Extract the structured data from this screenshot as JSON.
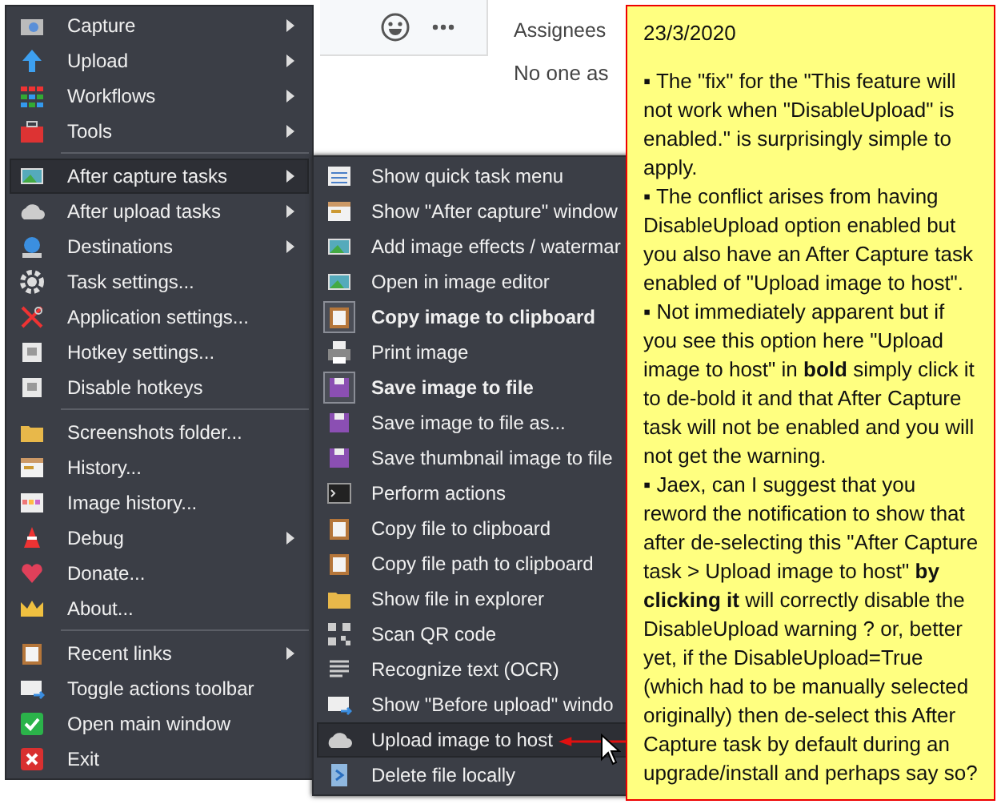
{
  "background": {
    "sidebar": [
      {
        "text": "Assignees",
        "kind": "heading"
      },
      {
        "text": "No one as",
        "kind": "value"
      }
    ]
  },
  "main_menu": [
    {
      "kind": "item",
      "label": "Capture",
      "submenu": true,
      "highlighted": false
    },
    {
      "kind": "item",
      "label": "Upload",
      "submenu": true,
      "highlighted": false
    },
    {
      "kind": "item",
      "label": "Workflows",
      "submenu": true,
      "highlighted": false
    },
    {
      "kind": "item",
      "label": "Tools",
      "submenu": true,
      "highlighted": false
    },
    {
      "kind": "separator"
    },
    {
      "kind": "item",
      "label": "After capture tasks",
      "submenu": true,
      "highlighted": true
    },
    {
      "kind": "item",
      "label": "After upload tasks",
      "submenu": true,
      "highlighted": false
    },
    {
      "kind": "item",
      "label": "Destinations",
      "submenu": true,
      "highlighted": false
    },
    {
      "kind": "item",
      "label": "Task settings...",
      "submenu": false,
      "highlighted": false
    },
    {
      "kind": "item",
      "label": "Application settings...",
      "submenu": false,
      "highlighted": false
    },
    {
      "kind": "item",
      "label": "Hotkey settings...",
      "submenu": false,
      "highlighted": false
    },
    {
      "kind": "item",
      "label": "Disable hotkeys",
      "submenu": false,
      "highlighted": false
    },
    {
      "kind": "separator"
    },
    {
      "kind": "item",
      "label": "Screenshots folder...",
      "submenu": false,
      "highlighted": false
    },
    {
      "kind": "item",
      "label": "History...",
      "submenu": false,
      "highlighted": false
    },
    {
      "kind": "item",
      "label": "Image history...",
      "submenu": false,
      "highlighted": false
    },
    {
      "kind": "item",
      "label": "Debug",
      "submenu": true,
      "highlighted": false
    },
    {
      "kind": "item",
      "label": "Donate...",
      "submenu": false,
      "highlighted": false
    },
    {
      "kind": "item",
      "label": "About...",
      "submenu": false,
      "highlighted": false
    },
    {
      "kind": "separator"
    },
    {
      "kind": "item",
      "label": "Recent links",
      "submenu": true,
      "highlighted": false
    },
    {
      "kind": "item",
      "label": "Toggle actions toolbar",
      "submenu": false,
      "highlighted": false
    },
    {
      "kind": "item",
      "label": "Open main window",
      "submenu": false,
      "highlighted": false
    },
    {
      "kind": "item",
      "label": "Exit",
      "submenu": false,
      "highlighted": false
    }
  ],
  "submenu": [
    {
      "label": "Show quick task menu",
      "checked": false,
      "highlighted": false
    },
    {
      "label": "Show \"After capture\" window",
      "checked": false,
      "highlighted": false
    },
    {
      "label": "Add image effects / watermar",
      "checked": false,
      "highlighted": false
    },
    {
      "label": "Open in image editor",
      "checked": false,
      "highlighted": false
    },
    {
      "label": "Copy image to clipboard",
      "checked": true,
      "highlighted": false
    },
    {
      "label": "Print image",
      "checked": false,
      "highlighted": false
    },
    {
      "label": "Save image to file",
      "checked": true,
      "highlighted": false
    },
    {
      "label": "Save image to file as...",
      "checked": false,
      "highlighted": false
    },
    {
      "label": "Save thumbnail image to file",
      "checked": false,
      "highlighted": false
    },
    {
      "label": "Perform actions",
      "checked": false,
      "highlighted": false
    },
    {
      "label": "Copy file to clipboard",
      "checked": false,
      "highlighted": false
    },
    {
      "label": "Copy file path to clipboard",
      "checked": false,
      "highlighted": false
    },
    {
      "label": "Show file in explorer",
      "checked": false,
      "highlighted": false
    },
    {
      "label": "Scan QR code",
      "checked": false,
      "highlighted": false
    },
    {
      "label": "Recognize text (OCR)",
      "checked": false,
      "highlighted": false
    },
    {
      "label": "Show \"Before upload\" windo",
      "checked": false,
      "highlighted": false
    },
    {
      "label": "Upload image to host",
      "checked": false,
      "highlighted": true
    },
    {
      "label": "Delete file locally",
      "checked": false,
      "highlighted": false
    }
  ],
  "note": {
    "date": "23/3/2020",
    "paragraphs": [
      "▪ The \"fix\" for the \"This feature will not work when \"DisableUpload\" is enabled.\" is surprisingly simple to apply.",
      "▪ The conflict arises from having DisableUpload option enabled but you also have an After Capture task enabled of \"Upload image to host\".",
      "▪ Not immediately apparent but if you see this option here \"Upload image to host\" in **bold** simply click it to de-bold it and that After Capture task will not be enabled and you will not get the warning.",
      "▪ Jaex, can I suggest that you reword the notification to show that after de-selecting this \"After Capture task > Upload image to host\" **by clicking it** will correctly disable the DisableUpload warning ? or, better yet, if the DisableUpload=True (which had to be manually selected originally) then de-select this After Capture task by default during an upgrade/install and perhaps say so?"
    ]
  }
}
